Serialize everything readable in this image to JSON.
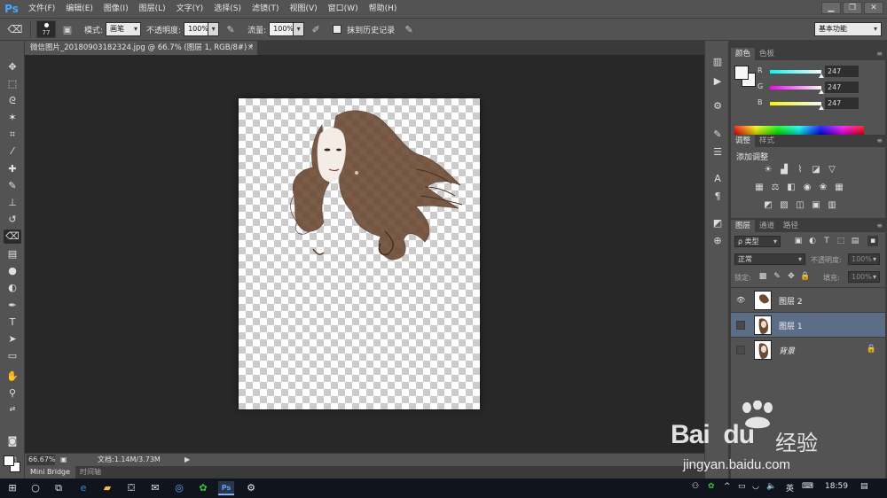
{
  "app": {
    "logo": "Ps"
  },
  "menu": [
    "文件(F)",
    "编辑(E)",
    "图像(I)",
    "图层(L)",
    "文字(Y)",
    "选择(S)",
    "滤镜(T)",
    "视图(V)",
    "窗口(W)",
    "帮助(H)"
  ],
  "window_buttons": [
    "▁",
    "❐",
    "✕"
  ],
  "options": {
    "brush_size": "77",
    "mode_label": "模式:",
    "mode_value": "画笔",
    "opacity_label": "不透明度:",
    "opacity_value": "100%",
    "flow_label": "流量:",
    "flow_value": "100%",
    "history_label": "抹到历史记录",
    "workspace": "基本功能"
  },
  "document": {
    "tab_title": "微信图片_20180903182324.jpg @ 66.7% (图层 1, RGB/8#) *",
    "close": "×"
  },
  "status": {
    "zoom": "66.67%",
    "doc_info": "文档:1.14M/3.73M",
    "arrow": "▶"
  },
  "bottom_tabs": [
    "Mini Bridge",
    "时间轴"
  ],
  "color_panel": {
    "tabs": [
      "颜色",
      "色板"
    ],
    "channels": [
      {
        "label": "R",
        "value": "247",
        "color": "#ff3b3b"
      },
      {
        "label": "G",
        "value": "247",
        "color": "#3bff3b"
      },
      {
        "label": "B",
        "value": "247",
        "color": "#3b6bff"
      }
    ]
  },
  "adjust_panel": {
    "tabs": [
      "调整",
      "样式"
    ],
    "title": "添加调整"
  },
  "layers_panel": {
    "tabs": [
      "图层",
      "通道",
      "路径"
    ],
    "filter_kind": "ρ 类型",
    "blend_mode": "正常",
    "opacity_label": "不透明度:",
    "opacity_value": "100%",
    "lock_label": "锁定:",
    "fill_label": "填充:",
    "fill_value": "100%",
    "layers": [
      {
        "name": "图层 2",
        "visible": true,
        "selected": false
      },
      {
        "name": "图层 1",
        "visible": false,
        "selected": true
      },
      {
        "name": "背景",
        "visible": false,
        "selected": false,
        "locked": true
      }
    ]
  },
  "taskbar": {
    "time": "18:59",
    "ime": "英",
    "tray_icons": [
      "people-icon",
      "wechat-icon",
      "network-icon",
      "volume-icon"
    ]
  },
  "watermark": {
    "brand": "Bai",
    "brand2": "du",
    "cn": "经验",
    "url": "jingyan.baidu.com"
  }
}
